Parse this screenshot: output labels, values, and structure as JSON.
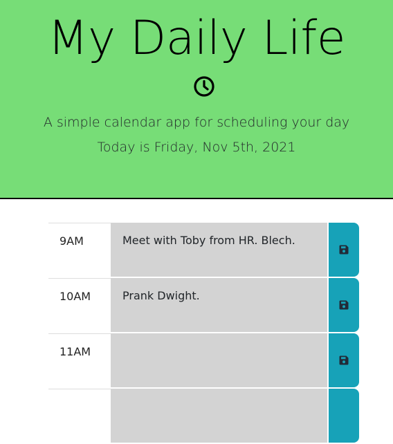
{
  "header": {
    "title": "My Daily Life",
    "clock_icon": "clock-icon",
    "tagline": "A simple calendar app for scheduling your day",
    "current_day": "Today is Friday, Nov 5th, 2021"
  },
  "colors": {
    "header_bg": "#77dd77",
    "past_block": "#d3d3d3",
    "save_button": "#17a2b8"
  },
  "timeblocks": [
    {
      "hour": "9AM",
      "text": "Meet with Toby from HR. Blech.",
      "save_icon": "save-icon"
    },
    {
      "hour": "10AM",
      "text": "Prank Dwight.",
      "save_icon": "save-icon"
    },
    {
      "hour": "11AM",
      "text": "",
      "save_icon": "save-icon"
    }
  ]
}
